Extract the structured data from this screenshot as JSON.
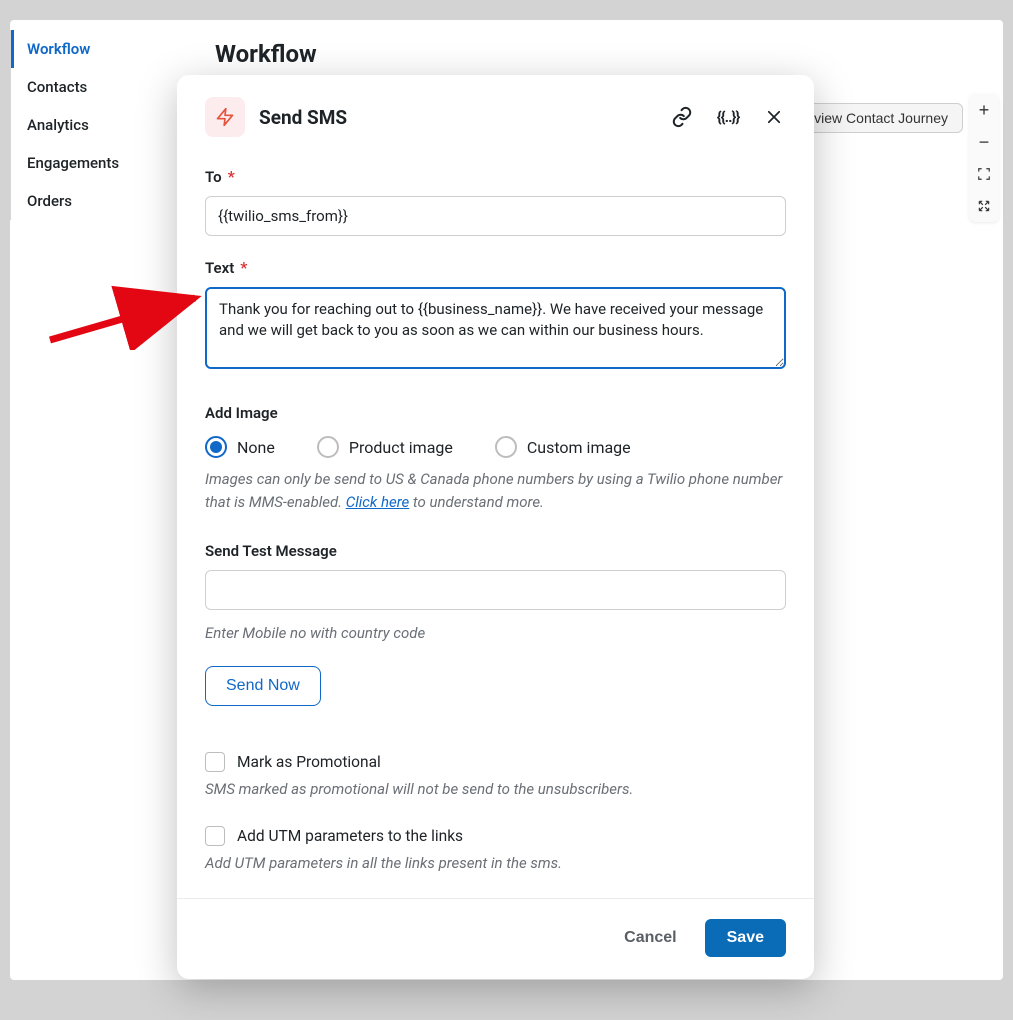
{
  "sidebar": {
    "items": [
      {
        "label": "Workflow",
        "active": true
      },
      {
        "label": "Contacts",
        "active": false
      },
      {
        "label": "Analytics",
        "active": false
      },
      {
        "label": "Engagements",
        "active": false
      },
      {
        "label": "Orders",
        "active": false
      }
    ]
  },
  "page": {
    "title": "Workflow",
    "preview_button": "Preview Contact Journey"
  },
  "modal": {
    "title": "Send SMS",
    "to_label": "To",
    "to_value": "{{twilio_sms_from}}",
    "text_label": "Text",
    "text_value": "Thank you for reaching out to {{business_name}}. We have received your message and we will get back to you as soon as we can within our business hours.",
    "add_image_label": "Add Image",
    "image_options": {
      "none": "None",
      "product": "Product image",
      "custom": "Custom image"
    },
    "image_help_prefix": "Images can only be send to US & Canada phone numbers by using a Twilio phone number that is MMS-enabled. ",
    "image_help_link": "Click here",
    "image_help_suffix": " to understand more.",
    "test_label": "Send Test Message",
    "test_hint": "Enter Mobile no with country code",
    "send_now": "Send Now",
    "promo_label": "Mark as Promotional",
    "promo_sub": "SMS marked as promotional will not be send to the unsubscribers.",
    "utm_label": "Add UTM parameters to the links",
    "utm_sub": "Add UTM parameters in all the links present in the sms.",
    "cancel": "Cancel",
    "save": "Save"
  }
}
